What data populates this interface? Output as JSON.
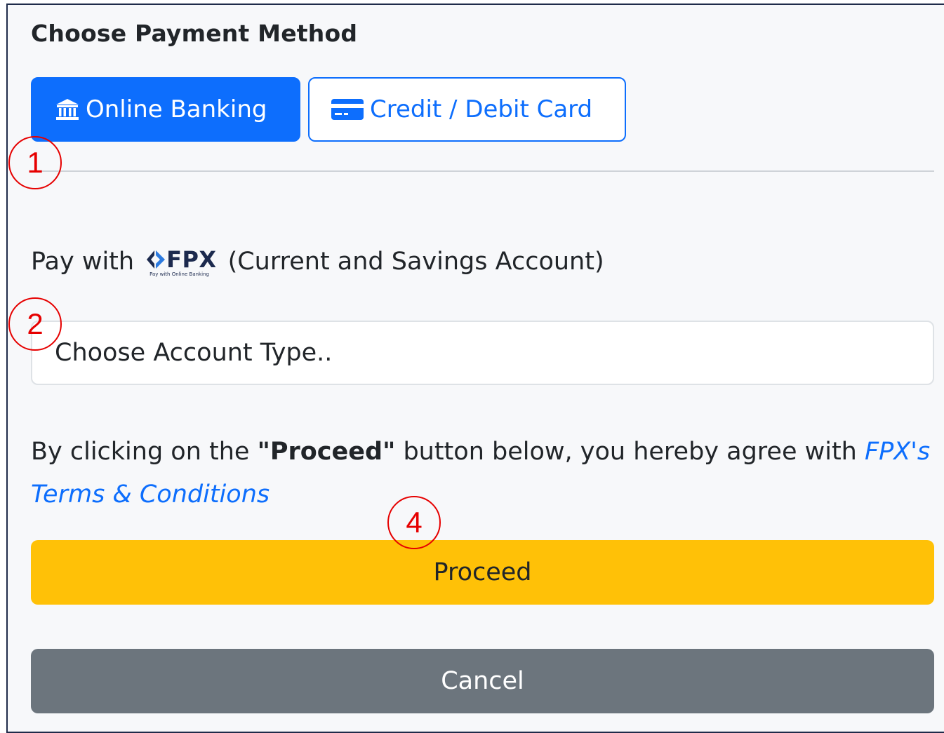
{
  "heading": "Choose Payment Method",
  "tabs": {
    "online_banking": {
      "label": "Online Banking",
      "icon": "bank-icon",
      "active": true
    },
    "card": {
      "label": "Credit / Debit Card",
      "icon": "credit-card-icon",
      "active": false
    }
  },
  "fpx": {
    "pay_with": "Pay with",
    "logo_text": "FPX",
    "logo_tagline": "Pay with Online Banking",
    "account_note": "(Current and Savings Account)"
  },
  "account_select": {
    "placeholder": "Choose Account Type.."
  },
  "terms": {
    "prefix": "By clicking on the ",
    "emphasis": "\"Proceed\"",
    "middle": " button below, you hereby agree with ",
    "link": "FPX's Terms & Conditions"
  },
  "buttons": {
    "proceed": "Proceed",
    "cancel": "Cancel"
  },
  "annotations": {
    "step1": "1",
    "step2": "2",
    "step4": "4",
    "color": "#e60000"
  },
  "colors": {
    "primary": "#0d6efd",
    "warning": "#ffc107",
    "secondary": "#6c757d"
  }
}
